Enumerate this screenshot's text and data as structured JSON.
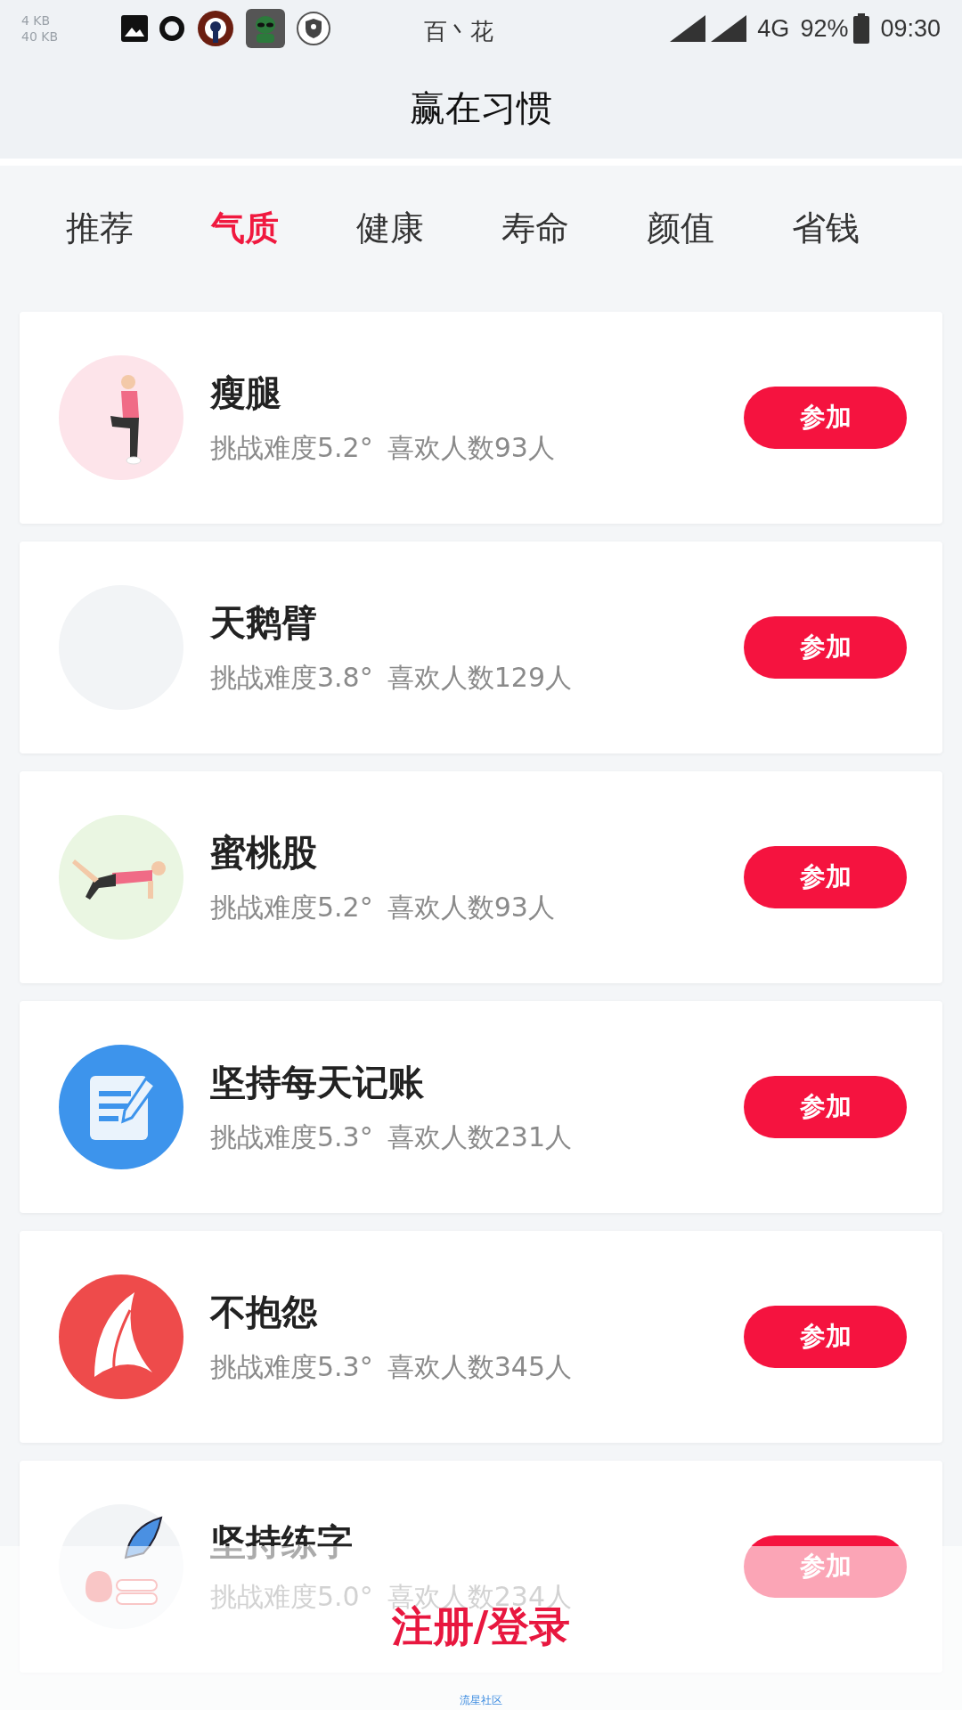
{
  "status_bar": {
    "upload_speed": "4 KB",
    "download_speed": "40 KB",
    "carrier": "百丶花",
    "network": "4G",
    "battery": "92%",
    "time": "09:30"
  },
  "header": {
    "title": "赢在习惯"
  },
  "tabs": [
    {
      "label": "推荐",
      "selected": false
    },
    {
      "label": "气质",
      "selected": true
    },
    {
      "label": "健康",
      "selected": false
    },
    {
      "label": "寿命",
      "selected": false
    },
    {
      "label": "颜值",
      "selected": false
    },
    {
      "label": "省钱",
      "selected": false
    }
  ],
  "habits": [
    {
      "kind": "stretch",
      "title": "瘦腿",
      "difficulty": "挑战难度5.2°",
      "likes": "喜欢人数93人",
      "button": "参加"
    },
    {
      "kind": "blank",
      "title": "天鹅臂",
      "difficulty": "挑战难度3.8°",
      "likes": "喜欢人数129人",
      "button": "参加"
    },
    {
      "kind": "plank",
      "title": "蜜桃股",
      "difficulty": "挑战难度5.2°",
      "likes": "喜欢人数93人",
      "button": "参加"
    },
    {
      "kind": "notepad",
      "title": "坚持每天记账",
      "difficulty": "挑战难度5.3°",
      "likes": "喜欢人数231人",
      "button": "参加"
    },
    {
      "kind": "feather",
      "title": "不抱怨",
      "difficulty": "挑战难度5.3°",
      "likes": "喜欢人数345人",
      "button": "参加"
    },
    {
      "kind": "quill",
      "title": "坚持练字",
      "difficulty": "挑战难度5.0°",
      "likes": "喜欢人数234人",
      "button": "参加"
    }
  ],
  "login_bar": {
    "label": "注册/登录",
    "footer": "流星社区"
  }
}
